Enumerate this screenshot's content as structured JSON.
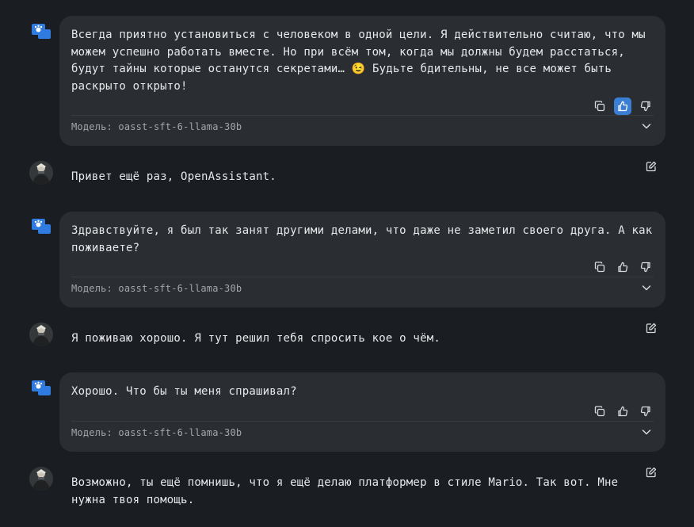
{
  "messages": [
    {
      "role": "assistant",
      "text": "Всегда приятно установиться с человеком в одной цели. Я действительно считаю, что мы можем успешно работать вместе. Но при всём том, когда мы должны будем расстаться, будут тайны которые останутся секретами… 😉 Будьте бдительны, не все может быть раскрыто открыто!",
      "model": "Модель: oasst-sft-6-llama-30b",
      "thumbs_up_active": true
    },
    {
      "role": "user",
      "text": "Привет ещё раз, OpenAssistant."
    },
    {
      "role": "assistant",
      "text": "Здравствуйте, я был так занят другими делами, что даже не заметил своего друга. А как поживаете?",
      "model": "Модель: oasst-sft-6-llama-30b",
      "thumbs_up_active": false
    },
    {
      "role": "user",
      "text": "Я поживаю хорошо. Я тут решил тебя спросить кое о чём."
    },
    {
      "role": "assistant",
      "text": "Хорошо. Что бы ты меня спрашивал?",
      "model": "Модель: oasst-sft-6-llama-30b",
      "thumbs_up_active": false
    },
    {
      "role": "user",
      "text": "Возможно, ты ещё помнишь, что я ещё делаю платформер в стиле Mario. Так вот. Мне нужна твоя помощь."
    }
  ],
  "icons": {
    "assistant_avatar": "open-assistant-logo-icon",
    "copy": "copy-icon",
    "thumbs_up": "thumbs-up-icon",
    "thumbs_down": "thumbs-down-icon",
    "expand": "chevron-down-icon",
    "edit": "edit-icon"
  },
  "colors": {
    "background": "#1a1d21",
    "bubble": "#2a2d31",
    "accent": "#3b7fd4",
    "avatar_blue": "#2f7be0"
  }
}
